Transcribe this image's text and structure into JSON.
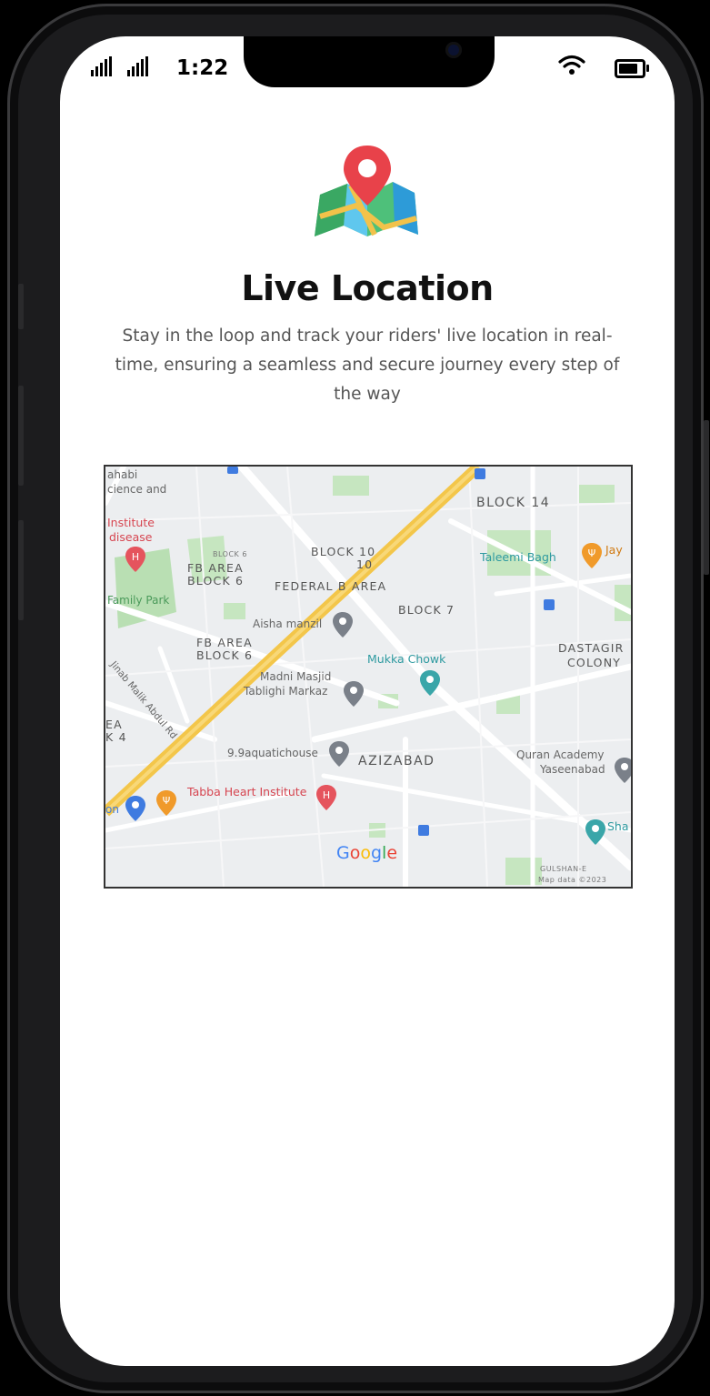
{
  "status_bar": {
    "time": "1:22",
    "signal_icons": [
      "signal-bars-icon",
      "signal-bars-icon"
    ],
    "wifi_icon": "wifi-icon",
    "battery_icon": "battery-icon"
  },
  "hero": {
    "icon": "map-pin-icon",
    "title": "Live Location",
    "description": "Stay in the loop and track your riders' live location in real-time, ensuring a seamless and secure journey every step of the way"
  },
  "map": {
    "labels": {
      "sahabi": "ahabi",
      "science": "cience and",
      "institute": "Institute",
      "disease": "disease",
      "family_park": "Family Park",
      "fb_area_1": "FB AREA",
      "block_6_1": "BLOCK 6",
      "block_6_small": "BLOCK 6",
      "block_10": "BLOCK 10",
      "block_10_sub": "10",
      "block_14": "BLOCK 14",
      "taleemi_bagh": "Taleemi Bagh",
      "jay": "Jay",
      "federal_b_area": "FEDERAL B AREA",
      "aisha_manzil": "Aisha manzil",
      "block_7": "BLOCK 7",
      "fb_area_2": "FB AREA",
      "block_6_2": "BLOCK 6",
      "mukka_chowk": "Mukka Chowk",
      "dastagir": "DASTAGIR",
      "colony": "COLONY",
      "madni_masjid": "Madni Masjid",
      "tablighi_markaz": "Tablighi Markaz",
      "rea": "EA",
      "block_4": "K 4",
      "aquatichouse": "9.9aquatichouse",
      "azizabad": "AZIZABAD",
      "quran_academy": "Quran Academy",
      "yaseenabad": "Yaseenabad",
      "tabba": "Tabba Heart Institute",
      "on": "on",
      "google": "Google",
      "gulshan": "GULSHAN-E",
      "map_data": "Map data ©2023",
      "sha": "Sha",
      "road": "Jinab Malik Abdul Rd"
    },
    "colors": {
      "highway": "#f3c64a",
      "road": "#ffffff",
      "park": "#b9dfb3",
      "base": "#eceef0",
      "pin_gray": "#7a8089",
      "pin_teal": "#3aa6a9",
      "pin_red": "#e5545d",
      "pin_orange": "#f09a2a",
      "pin_blue": "#3f7be0"
    }
  }
}
